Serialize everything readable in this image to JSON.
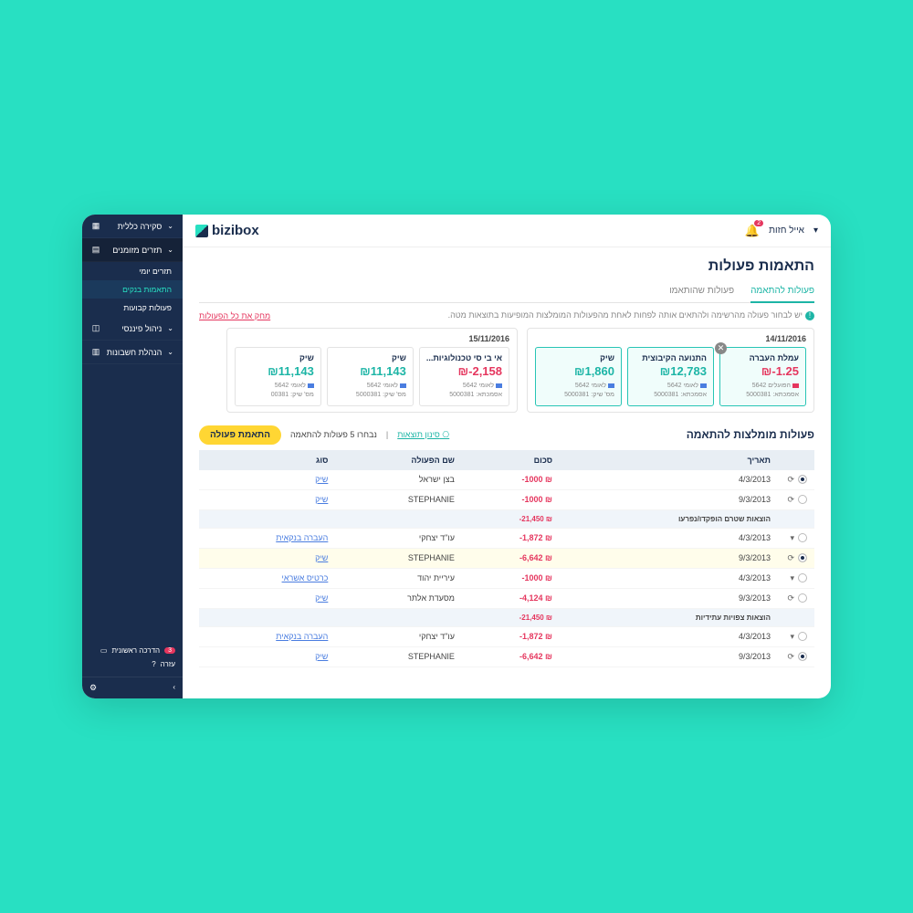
{
  "brand": "bizibox",
  "user": {
    "name": "אייל חזות",
    "notif_count": "2"
  },
  "sidebar": {
    "items": [
      {
        "label": "סקירה כללית",
        "icon": "▦"
      },
      {
        "label": "תזרים מזומנים",
        "icon": "▤",
        "expanded": true,
        "subs": [
          {
            "label": "תזרים יומי"
          },
          {
            "label": "התאמות בנקים",
            "active": true
          },
          {
            "label": "פעולות קבועות"
          }
        ]
      },
      {
        "label": "ניהול פיננסי",
        "icon": "◫"
      },
      {
        "label": "הנהלת חשבונות",
        "icon": "▥"
      }
    ],
    "footer": {
      "guide": "הדרכה ראשונית",
      "guide_badge": "3",
      "help": "עזרה"
    }
  },
  "page": {
    "title": "התאמות פעולות",
    "tabs": [
      {
        "label": "פעולות להתאמה",
        "active": true
      },
      {
        "label": "פעולות שהותאמו"
      }
    ],
    "info": "יש לבחור פעולה מהרשימה ולהתאים אותה לפחות לאחת מהפעולות המומלצות המופיעות בתוצאות מטה.",
    "delete_all": "מחק את כל הפעולות",
    "groups": [
      {
        "date": "14/11/2016",
        "cards": [
          {
            "title": "עמלת העברה",
            "amount": "-1.25",
            "cls": "neg",
            "bank": "הפועלים 5642",
            "ref": "אסמכתא: 5000381",
            "dot": "red",
            "selected": true,
            "close": true
          },
          {
            "title": "התנועה הקיבוצית",
            "amount": "12,783",
            "cls": "pos",
            "bank": "לאומי 5642",
            "ref": "אסמכתא: 5000381",
            "dot": "blue",
            "selected": true
          },
          {
            "title": "שיק",
            "amount": "1,860",
            "cls": "pos",
            "bank": "לאומי 5642",
            "ref": "מס' שיק: 5000381",
            "dot": "blue",
            "selected": true
          }
        ]
      },
      {
        "date": "15/11/2016",
        "cards": [
          {
            "title": "אי בי סי טכנולוגיות...",
            "amount": "-2,158",
            "cls": "neg",
            "bank": "לאומי 5642",
            "ref": "אסמכתא: 5000381",
            "dot": "blue"
          },
          {
            "title": "שיק",
            "amount": "11,143",
            "cls": "pos",
            "bank": "לאומי 5642",
            "ref": "מס' שיק: 5000381",
            "dot": "blue"
          },
          {
            "title": "שיק",
            "amount": "11,143",
            "cls": "pos",
            "bank": "לאומי 5642",
            "ref": "מס' שיק: 00381",
            "dot": "blue"
          }
        ]
      }
    ],
    "rec": {
      "title": "פעולות מומלצות להתאמה",
      "filter": "סינון תוצאות",
      "count_text": "נבחרו 5 פעולות להתאמה",
      "button": "התאמת פעולה",
      "headers": {
        "date": "תאריך",
        "amount": "סכום",
        "name": "שם הפעולה",
        "type": "סוג"
      },
      "rows": [
        {
          "check": true,
          "icon": "⟳",
          "date": "4/3/2013",
          "amount": "-1000",
          "name": "בצן ישראל",
          "type": "שיק",
          "type_link": true
        },
        {
          "check": false,
          "icon": "⟳",
          "date": "9/3/2013",
          "amount": "-1000",
          "name": "STEPHANIE",
          "type": "שיק",
          "type_link": true
        },
        {
          "subtotal": true,
          "amount": "-21,450",
          "label": "הוצאות שטרם הופקדו/נפרעו"
        },
        {
          "check": false,
          "icon": "▾",
          "date": "4/3/2013",
          "amount": "-1,872",
          "name": "עו\"ד יצחקי",
          "type": "העברה בנקאית",
          "type_link": true
        },
        {
          "hl": true,
          "check": true,
          "icon": "⟳",
          "date": "9/3/2013",
          "amount": "-6,642",
          "name": "STEPHANIE",
          "type": "שיק",
          "type_link": true
        },
        {
          "check": false,
          "icon": "▾",
          "date": "4/3/2013",
          "amount": "-1000",
          "name": "עיריית יהוד",
          "type": "כרטיס אשראי",
          "type_link": true
        },
        {
          "check": false,
          "icon": "⟳",
          "date": "9/3/2013",
          "amount": "-4,124",
          "name": "מסעדת אלתר",
          "type": "שיק",
          "type_link": true
        },
        {
          "subtotal": true,
          "amount": "-21,450",
          "label": "הוצאות צפויות עתידיות"
        },
        {
          "check": false,
          "icon": "▾",
          "date": "4/3/2013",
          "amount": "-1,872",
          "name": "עו\"ד יצחקי",
          "type": "העברה בנקאית",
          "type_link": true
        },
        {
          "check": true,
          "icon": "⟳",
          "date": "9/3/2013",
          "amount": "-6,642",
          "name": "STEPHANIE",
          "type": "שיק",
          "type_link": true
        }
      ]
    }
  }
}
